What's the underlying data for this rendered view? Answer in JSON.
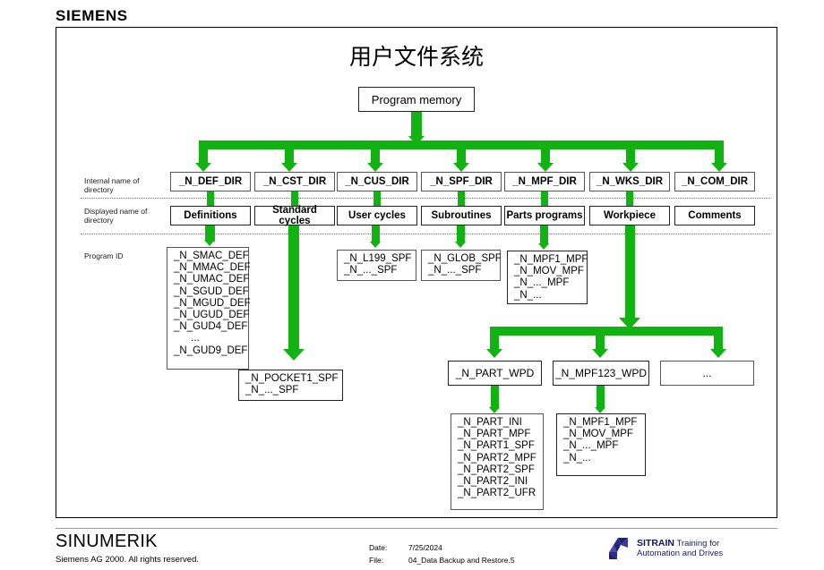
{
  "header": {
    "brand": "SIEMENS"
  },
  "slide": {
    "title": "用户文件系统",
    "root": {
      "label": "Program memory"
    }
  },
  "row_labels": [
    {
      "line1": "Internal name of",
      "line2": "directory"
    },
    {
      "line1": "Displayed name of",
      "line2": "directory"
    },
    {
      "line1": "Program ID",
      "line2": ""
    }
  ],
  "directories": [
    {
      "internal": "_N_DEF_DIR",
      "displayed": "Definitions"
    },
    {
      "internal": "_N_CST_DIR",
      "displayed": "Standard cycles"
    },
    {
      "internal": "_N_CUS_DIR",
      "displayed": "User cycles"
    },
    {
      "internal": "_N_SPF_DIR",
      "displayed": "Subroutines"
    },
    {
      "internal": "_N_MPF_DIR",
      "displayed": "Parts programs"
    },
    {
      "internal": "_N_WKS_DIR",
      "displayed": "Workpiece"
    },
    {
      "internal": "_N_COM_DIR",
      "displayed": "Comments"
    }
  ],
  "program_ids": {
    "def": [
      "_N_SMAC_DEF",
      "_N_MMAC_DEF",
      "_N_UMAC_DEF",
      "_N_SGUD_DEF",
      "_N_MGUD_DEF",
      "_N_UGUD_DEF",
      "_N_GUD4_DEF",
      "      ...",
      "_N_GUD9_DEF"
    ],
    "cst": [
      "_N_POCKET1_SPF",
      "_N_..._SPF"
    ],
    "cus": [
      "_N_L199_SPF",
      "_N_..._SPF"
    ],
    "spf": [
      "_N_GLOB_SPF",
      "_N_..._SPF"
    ],
    "mpf": [
      "_N_MPF1_MPF",
      "_N_MOV_MPF",
      "_N_..._MPF",
      "_N_..."
    ]
  },
  "workpieces": [
    {
      "label": "_N_PART_WPD"
    },
    {
      "label": "_N_MPF123_WPD"
    },
    {
      "label": "..."
    }
  ],
  "workpiece_contents": {
    "part": [
      "_N_PART_INI",
      "_N_PART_MPF",
      "_N_PART1_SPF",
      "_N_PART2_MPF",
      "_N_PART2_SPF",
      "_N_PART2_INI",
      "_N_PART2_UFR"
    ],
    "mpf123": [
      "_N_MPF1_MPF",
      "_N_MOV_MPF",
      "_N_..._MPF",
      "_N_..."
    ]
  },
  "footer": {
    "product": "SINUMERIK",
    "copyright": "Siemens AG 2000. All rights reserved.",
    "date_key": "Date:",
    "date_value": "7/25/2024",
    "file_key": "File:",
    "file_value": "04_Data Backup and Restore.5",
    "sitrain_name": "SITRAIN",
    "sitrain_line1": " Training for",
    "sitrain_line2": "Automation and Drives"
  },
  "colors": {
    "arrow_green": "#12b212",
    "sitrain_blue": "#20207a",
    "frame_black": "#000000"
  }
}
